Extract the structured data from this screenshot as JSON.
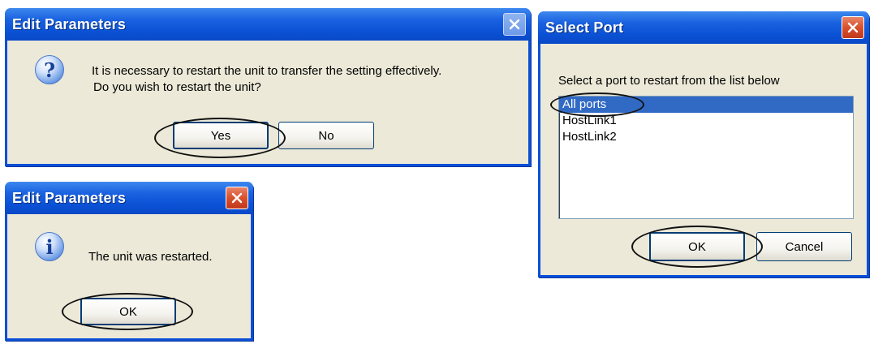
{
  "dialog_restart": {
    "title": "Edit Parameters",
    "icon": "question-icon",
    "icon_glyph": "?",
    "message_line1": "It is necessary to restart the unit to transfer the setting effectively.",
    "message_line2": "Do you wish to restart the unit?",
    "yes_label": "Yes",
    "no_label": "No"
  },
  "dialog_restarted": {
    "title": "Edit Parameters",
    "icon": "info-icon",
    "icon_glyph": "i",
    "message": "The unit was restarted.",
    "ok_label": "OK"
  },
  "dialog_select_port": {
    "title": "Select Port",
    "instruction": "Select a port to restart from the list below",
    "ports": [
      {
        "label": "All ports",
        "selected": true
      },
      {
        "label": "HostLink1",
        "selected": false
      },
      {
        "label": "HostLink2",
        "selected": false
      }
    ],
    "ok_label": "OK",
    "cancel_label": "Cancel"
  },
  "colors": {
    "titlebar": "#0a4fd6",
    "client": "#ece9d8",
    "selection": "#316ac5",
    "close": "#d8502c"
  }
}
